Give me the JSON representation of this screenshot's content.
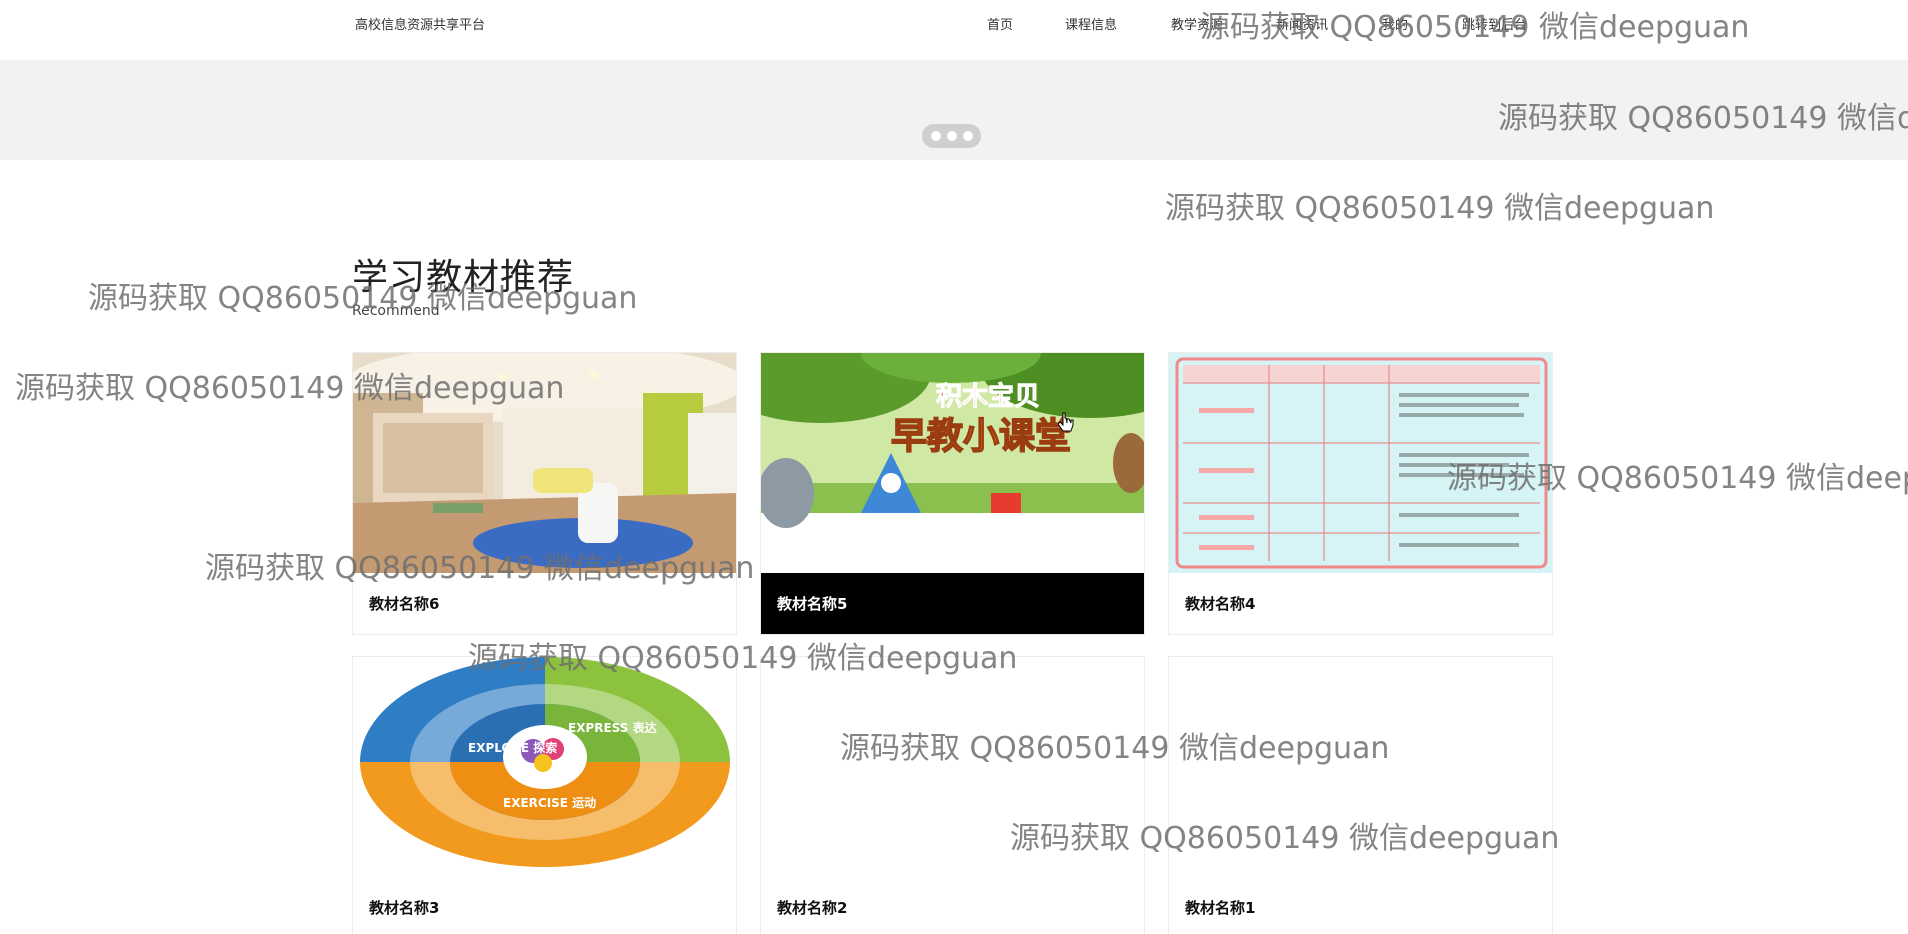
{
  "header": {
    "brand": "高校信息资源共享平台",
    "nav": [
      "首页",
      "课程信息",
      "教学资源",
      "新闻资讯",
      "我的",
      "跳转到后台"
    ]
  },
  "banner": {
    "dots": 3
  },
  "section": {
    "title": "学习教材推荐",
    "subtitle": "Recommend"
  },
  "cards": [
    {
      "name": "教材名称6",
      "image": "classroom-photo"
    },
    {
      "name": "教材名称5",
      "image": "early-education-banner",
      "active": true
    },
    {
      "name": "教材名称4",
      "image": "course-table-image"
    },
    {
      "name": "教材名称3",
      "image": "circular-diagram-image"
    },
    {
      "name": "教材名称2",
      "image": ""
    },
    {
      "name": "教材名称1",
      "image": ""
    }
  ],
  "early_edu_banner_text": {
    "top": "积木宝贝",
    "main": "早教小课堂"
  },
  "diagram_labels": {
    "left": "EXPLORE 探索",
    "right": "EXPRESS 表达",
    "bottom": "EXERCISE 运动"
  },
  "watermark": "源码获取 QQ86050149 微信deepguan"
}
